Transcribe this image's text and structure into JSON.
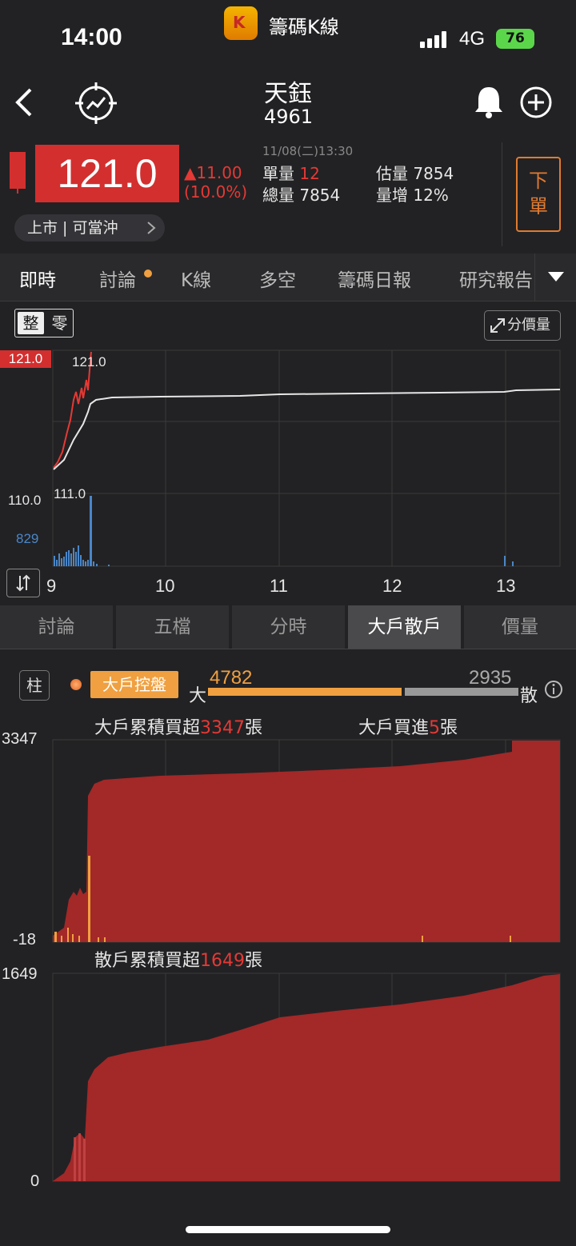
{
  "status": {
    "time": "14:00",
    "app_name": "籌碼K線",
    "network": "4G",
    "battery": "76"
  },
  "stock": {
    "name": "天鈺",
    "code": "4961"
  },
  "quote": {
    "price": "121.0",
    "change": "▲11.00",
    "change_pct": "(10.0%)",
    "datetime": "11/08(二)13:30",
    "single_vol_label": "單量",
    "single_vol": "12",
    "est_vol_label": "估量",
    "est_vol": "7854",
    "total_vol_label": "總量",
    "total_vol": "7854",
    "vol_inc_label": "量增",
    "vol_inc": "12%",
    "market_tag": "上市 | 可當沖",
    "order_button": [
      "下",
      "單"
    ]
  },
  "tabs": [
    "即時",
    "討論",
    "K線",
    "多空",
    "籌碼日報",
    "研究報告"
  ],
  "intraday": {
    "seg_whole": "整",
    "seg_odd": "零",
    "price_volume_button": "分價量",
    "price_high_label": "121.0",
    "price_high_annot": "121.0",
    "price_low_label": "110.0",
    "price_low_annot": "111.0",
    "vol_max_label": "829",
    "x_ticks": [
      "9",
      "10",
      "11",
      "12",
      "13"
    ]
  },
  "bottom_tabs": [
    "討論",
    "五檔",
    "分時",
    "大戶散戶",
    "價量"
  ],
  "big_small": {
    "side_button": "柱",
    "control_label": "大戶控盤",
    "big_label": "大",
    "big_value": "4782",
    "small_label": "散",
    "small_value": "2935",
    "big_cum_prefix": "大戶累積買超",
    "big_cum_value": "3347",
    "unit": "張",
    "big_buy_prefix": "大戶買進",
    "big_buy_value": "5",
    "small_cum_prefix": "散戶累積買超",
    "small_cum_value": "1649",
    "big_y_max": "3347",
    "big_y_min": "-18",
    "small_y_max": "1649",
    "small_y_min": "0"
  },
  "chart_data": [
    {
      "type": "line",
      "title": "",
      "x_ticks": [
        "9",
        "10",
        "11",
        "12",
        "13"
      ],
      "ylim": [
        110.0,
        121.0
      ],
      "series": [
        {
          "values": [
            111.0,
            113.5,
            117.0,
            119.5,
            121.0,
            121.0
          ]
        },
        {
          "values": [
            111.2,
            112.0,
            118.5,
            119.0,
            119.2,
            119.4,
            119.6,
            119.7
          ]
        }
      ]
    },
    {
      "type": "area",
      "title": "大戶累積買超3347張",
      "ylim": [
        -18,
        3347
      ],
      "values": [
        0,
        300,
        600,
        2800,
        2950,
        3000,
        3050,
        3100,
        3150,
        3200,
        3347
      ]
    },
    {
      "type": "area",
      "title": "散戶累積買超1649張",
      "ylim": [
        0,
        1649
      ],
      "values": [
        0,
        200,
        350,
        1000,
        1100,
        1200,
        1300,
        1350,
        1400,
        1500,
        1649
      ]
    }
  ]
}
